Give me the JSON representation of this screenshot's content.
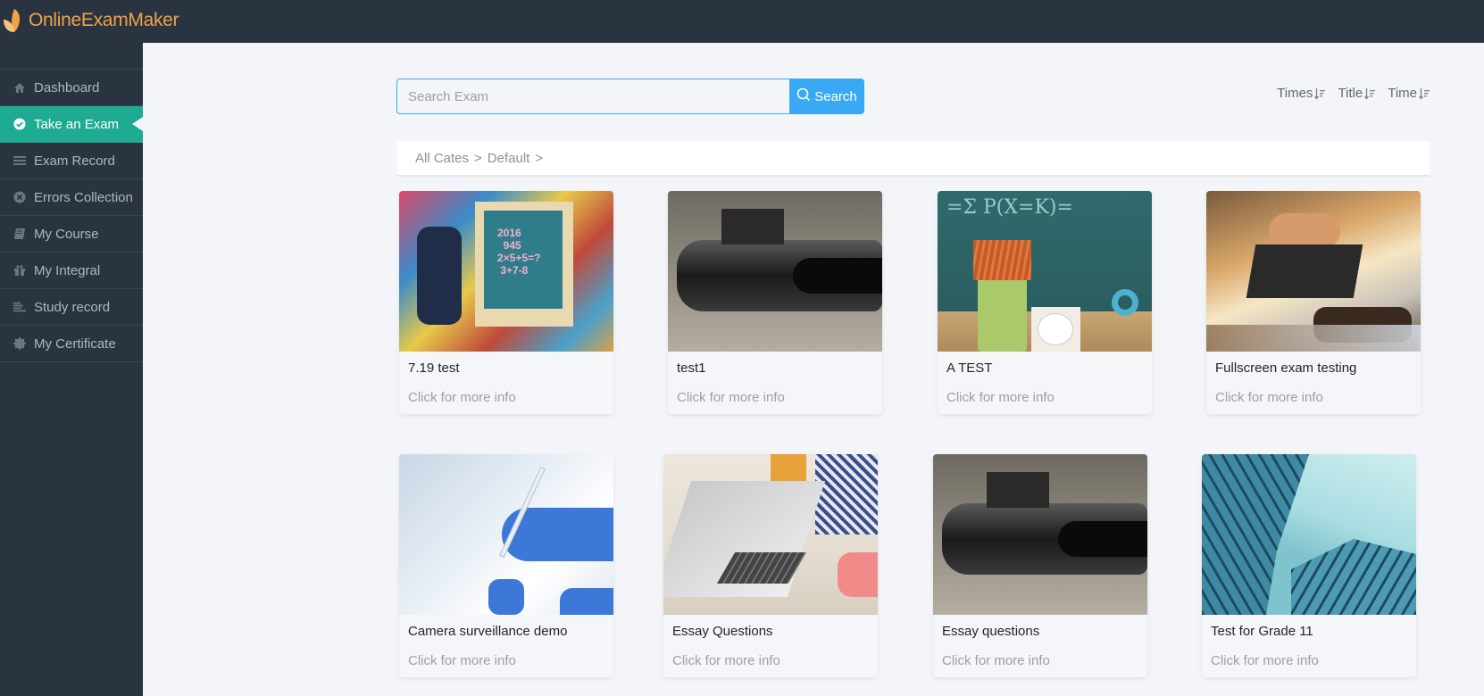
{
  "app": {
    "name": "OnlineExamMaker",
    "brand_color": "#f0a14a",
    "accent_color": "#1eab91",
    "header_bg": "#2a3441"
  },
  "sidebar": {
    "items": [
      {
        "label": "Dashboard",
        "icon": "home-icon",
        "active": false
      },
      {
        "label": "Take an Exam",
        "icon": "check-circle-icon",
        "active": true
      },
      {
        "label": "Exam Record",
        "icon": "list-icon",
        "active": false
      },
      {
        "label": "Errors Collection",
        "icon": "x-circle-icon",
        "active": false
      },
      {
        "label": "My Course",
        "icon": "book-icon",
        "active": false
      },
      {
        "label": "My Integral",
        "icon": "gift-icon",
        "active": false
      },
      {
        "label": "Study record",
        "icon": "align-left-icon",
        "active": false
      },
      {
        "label": "My Certificate",
        "icon": "certificate-icon",
        "active": false
      }
    ]
  },
  "search": {
    "placeholder": "Search Exam",
    "value": "",
    "button_label": "Search",
    "button_color": "#3aa9f4"
  },
  "sort": [
    {
      "label": "Times"
    },
    {
      "label": "Title"
    },
    {
      "label": "Time"
    }
  ],
  "breadcrumb": {
    "items": [
      "All Cates",
      ">",
      "Default",
      ">"
    ]
  },
  "exams": [
    {
      "title": "7.19 test",
      "subtitle": "Click for more info",
      "image": "easel-chalkboard"
    },
    {
      "title": "test1",
      "subtitle": "Click for more info",
      "image": "steam-engine"
    },
    {
      "title": "A TEST",
      "subtitle": "Click for more info",
      "image": "pencils-chalkboard"
    },
    {
      "title": "Fullscreen exam testing",
      "subtitle": "Click for more info",
      "image": "handshake"
    },
    {
      "title": "Camera surveillance demo",
      "subtitle": "Click for more info",
      "image": "gloved-hand-writing"
    },
    {
      "title": "Essay Questions",
      "subtitle": "Click for more info",
      "image": "laptop-coffee"
    },
    {
      "title": "Essay questions",
      "subtitle": "Click for more info",
      "image": "steam-engine"
    },
    {
      "title": "Test for Grade 11",
      "subtitle": "Click for more info",
      "image": "glass-buildings"
    }
  ]
}
